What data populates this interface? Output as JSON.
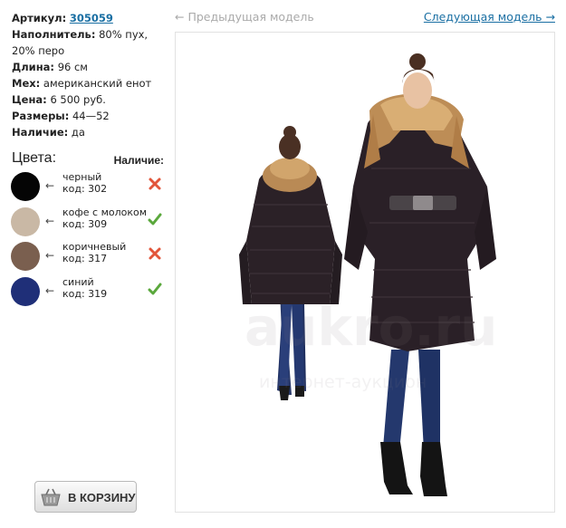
{
  "specs": {
    "article": {
      "label": "Артикул:",
      "value": "305059"
    },
    "filler": {
      "label": "Наполнитель:",
      "value": "80% пух, 20% перо"
    },
    "length": {
      "label": "Длина:",
      "value": "96 см"
    },
    "fur": {
      "label": "Мех:",
      "value": "американский енот"
    },
    "price": {
      "label": "Цена:",
      "value": "6 500 руб."
    },
    "sizes": {
      "label": "Размеры:",
      "value": "44—52"
    },
    "availability": {
      "label": "Наличие:",
      "value": "да"
    }
  },
  "colors_section": {
    "title": "Цвета:",
    "availability_title": "Наличие:",
    "arrow": "←",
    "items": [
      {
        "name": "черный",
        "code": "код: 302",
        "swatch": "#050505",
        "available": false,
        "mark": "cross-icon"
      },
      {
        "name": "кофе с молоком",
        "code": "код: 309",
        "swatch": "#c9b8a5",
        "available": true,
        "mark": "check-icon"
      },
      {
        "name": "коричневый",
        "code": "код: 317",
        "swatch": "#7a5f4f",
        "available": false,
        "mark": "cross-icon"
      },
      {
        "name": "синий",
        "code": "код: 319",
        "swatch": "#1f2f78",
        "available": true,
        "mark": "check-icon"
      }
    ]
  },
  "nav": {
    "prev": "← Предыдущая модель",
    "next": "Следующая модель →"
  },
  "cart": {
    "label": "В КОРЗИНУ",
    "icon": "basket-icon"
  },
  "photo": {
    "watermark_line1": "aukro.ru",
    "watermark_line2": "интернет-аукцион"
  },
  "colors": {
    "link": "#1a6fa3",
    "muted": "#aaaaaa",
    "cross": "#e2553a",
    "check": "#5aa83c"
  }
}
